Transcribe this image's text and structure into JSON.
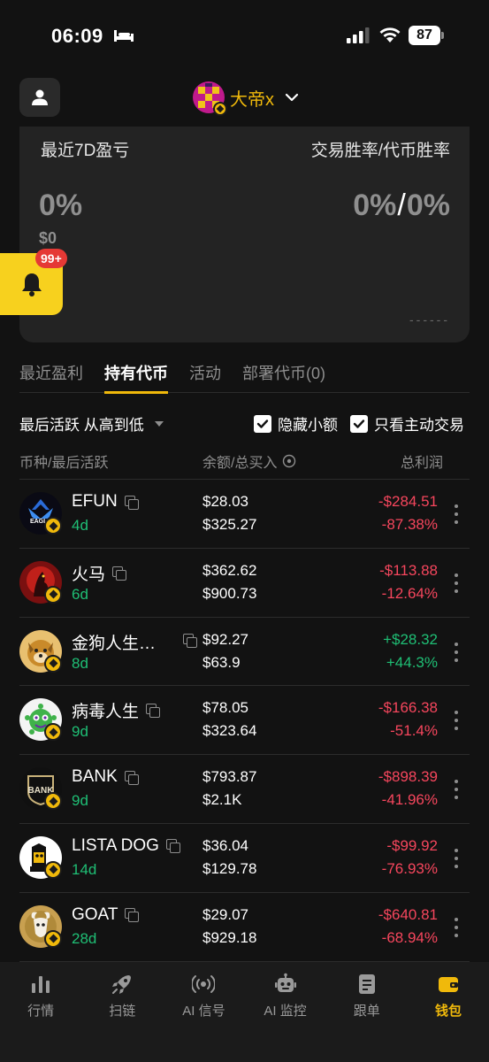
{
  "status_bar": {
    "time": "06:09",
    "battery": "87"
  },
  "header": {
    "account_name": "大帝x"
  },
  "stats": {
    "left_label": "最近7D盈亏",
    "right_label": "交易胜率/代币胜率",
    "pnl_percent": "0%",
    "pnl_usd": "$0",
    "trade_winrate": "0%",
    "token_winrate": "0%",
    "slash": "/",
    "dashes": "------"
  },
  "notifications": {
    "badge": "99+"
  },
  "tabs": [
    {
      "label": "最近盈利",
      "active": false
    },
    {
      "label": "持有代币",
      "active": true
    },
    {
      "label": "活动",
      "active": false
    },
    {
      "label": "部署代币(0)",
      "active": false
    }
  ],
  "filters": {
    "sort_label": "最后活跃 从高到低",
    "hide_small_label": "隐藏小额",
    "active_trade_label": "只看主动交易"
  },
  "columns": {
    "coin": "币种/最后活跃",
    "balance": "余额/总买入",
    "pnl": "总利润"
  },
  "tokens": [
    {
      "name": "EFUN",
      "age": "4d",
      "balance": "$28.03",
      "total_buy": "$325.27",
      "pnl": "-$284.51",
      "pnl_pct": "-87.38%",
      "positive": false
    },
    {
      "name": "火马",
      "age": "6d",
      "balance": "$362.62",
      "total_buy": "$900.73",
      "pnl": "-$113.88",
      "pnl_pct": "-12.64%",
      "positive": false
    },
    {
      "name": "金狗人生…",
      "age": "8d",
      "balance": "$92.27",
      "total_buy": "$63.9",
      "pnl": "+$28.32",
      "pnl_pct": "+44.3%",
      "positive": true
    },
    {
      "name": "病毒人生",
      "age": "9d",
      "balance": "$78.05",
      "total_buy": "$323.64",
      "pnl": "-$166.38",
      "pnl_pct": "-51.4%",
      "positive": false
    },
    {
      "name": "BANK",
      "age": "9d",
      "balance": "$793.87",
      "total_buy": "$2.1K",
      "pnl": "-$898.39",
      "pnl_pct": "-41.96%",
      "positive": false
    },
    {
      "name": "LISTA DOG",
      "age": "14d",
      "balance": "$36.04",
      "total_buy": "$129.78",
      "pnl": "-$99.92",
      "pnl_pct": "-76.93%",
      "positive": false
    },
    {
      "name": "GOAT",
      "age": "28d",
      "balance": "$29.07",
      "total_buy": "$929.18",
      "pnl": "-$640.81",
      "pnl_pct": "-68.94%",
      "positive": false
    }
  ],
  "bottom_nav": [
    {
      "label": "行情",
      "icon": "chart-bars-icon",
      "active": false
    },
    {
      "label": "扫链",
      "icon": "rocket-icon",
      "active": false
    },
    {
      "label": "AI 信号",
      "icon": "signal-icon",
      "active": false
    },
    {
      "label": "AI 监控",
      "icon": "robot-icon",
      "active": false
    },
    {
      "label": "跟单",
      "icon": "document-icon",
      "active": false
    },
    {
      "label": "钱包",
      "icon": "wallet-icon",
      "active": true
    }
  ],
  "colors": {
    "accent": "#f0b90b",
    "positive": "#1fbf75",
    "negative": "#f6465d",
    "background": "#121212"
  }
}
